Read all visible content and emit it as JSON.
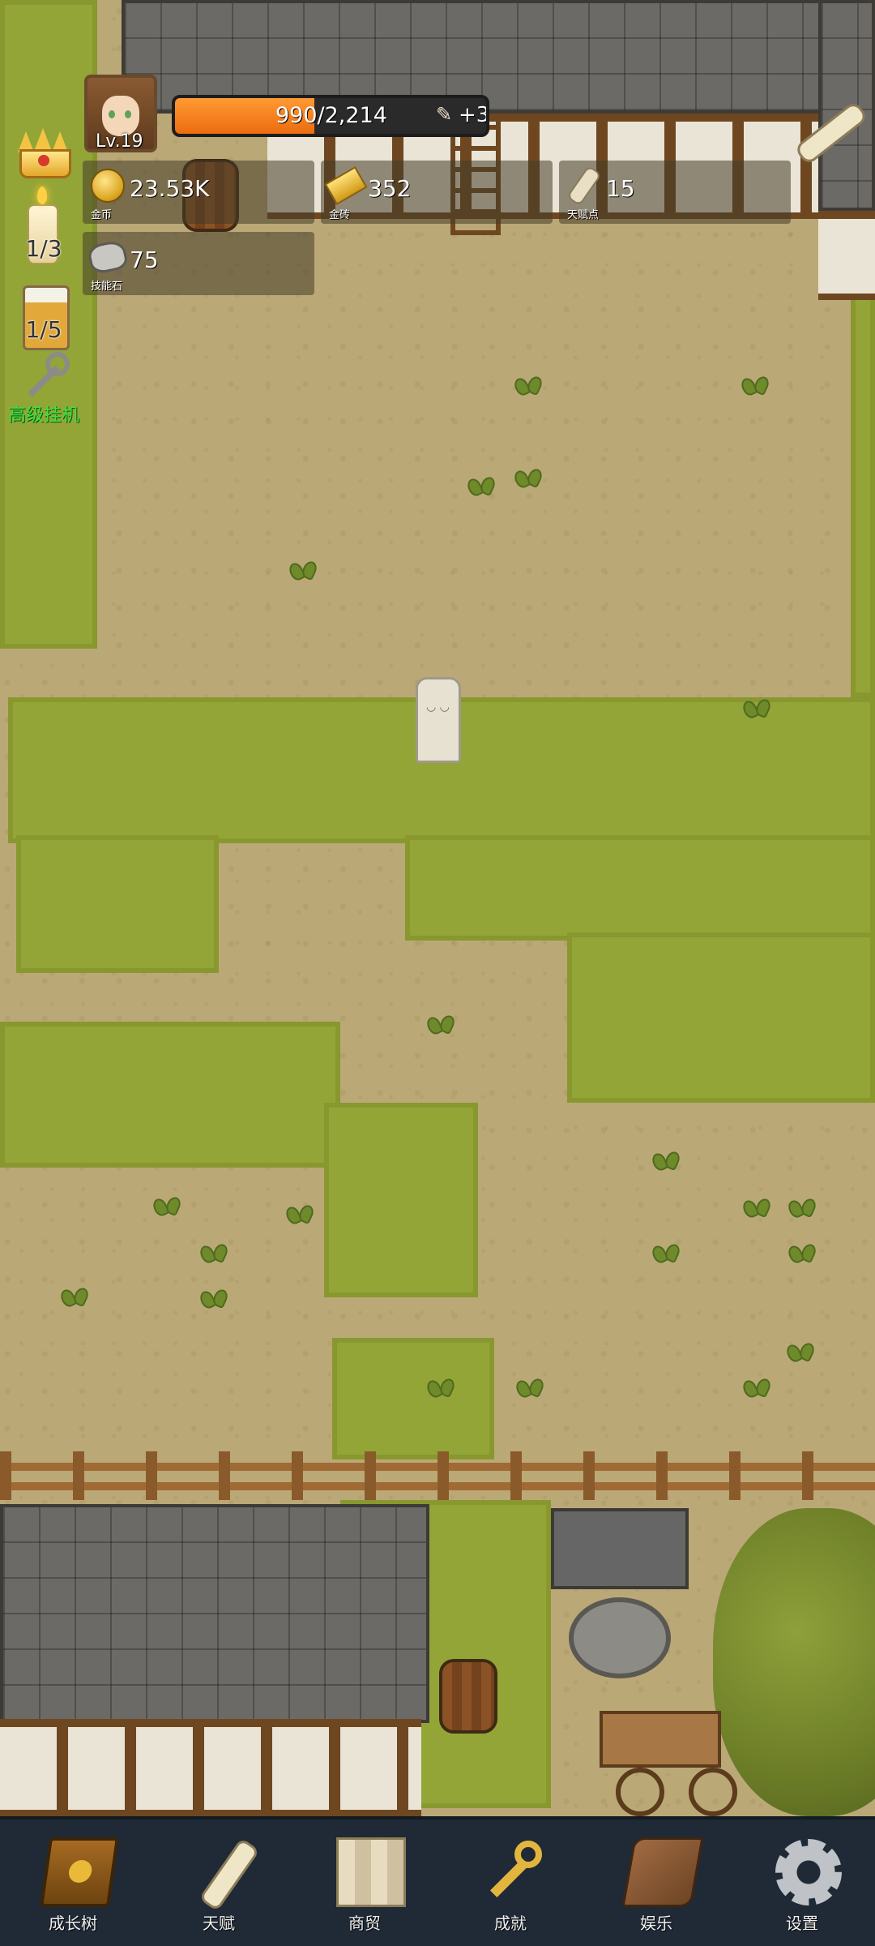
{
  "player": {
    "level": "Lv.19",
    "xp_text": "990/2,214",
    "xp_fraction": 0.447,
    "bonus_text": "+3",
    "bonus_icon": "scroll-icon"
  },
  "resources": {
    "gold": {
      "value": "23.53K",
      "label": "金币",
      "icon": "gold-coin-icon"
    },
    "gold_brick": {
      "value": "352",
      "label": "金砖",
      "icon": "gold-brick-icon"
    },
    "talent_points": {
      "value": "15",
      "label": "天赋点",
      "icon": "scroll-icon"
    },
    "skill_stone": {
      "value": "75",
      "label": "技能石",
      "icon": "stone-icon"
    }
  },
  "side": {
    "candle_count": "1/3",
    "beer_count": "1/5",
    "idle_label": "高级挂机"
  },
  "nav": [
    {
      "label": "成长树",
      "icon": "book-icon"
    },
    {
      "label": "天赋",
      "icon": "scroll-icon"
    },
    {
      "label": "商贸",
      "icon": "map-icon"
    },
    {
      "label": "成就",
      "icon": "key-icon"
    },
    {
      "label": "娱乐",
      "icon": "scroll-banner-icon"
    },
    {
      "label": "设置",
      "icon": "gear-icon"
    }
  ],
  "colors": {
    "xp_fill": "#ec6c0f",
    "idle_label": "#3de23d",
    "nav_bg": "#1f2a36",
    "grass": "#93a537",
    "dirt": "#bba877"
  }
}
